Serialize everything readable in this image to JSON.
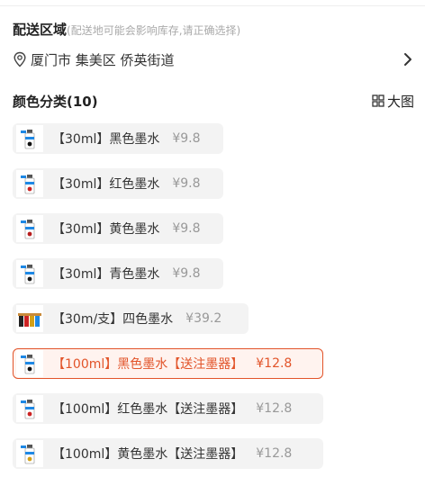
{
  "delivery": {
    "title": "配送区域",
    "hint": "(配送地可能会影响库存,请正确选择)",
    "address": "厦门市 集美区 侨英街道"
  },
  "colors": {
    "label": "颜色分类(10)",
    "big_view": "大图",
    "options": [
      {
        "name": "【30ml】黑色墨水",
        "price": "¥9.8",
        "dot": "#111111",
        "selected": false
      },
      {
        "name": "【30ml】红色墨水",
        "price": "¥9.8",
        "dot": "#cc2222",
        "selected": false
      },
      {
        "name": "【30ml】黄色墨水",
        "price": "¥9.8",
        "dot": "#b71c1c",
        "selected": false
      },
      {
        "name": "【30ml】青色墨水",
        "price": "¥9.8",
        "dot": "#1a1a1a",
        "selected": false
      },
      {
        "name": "【30m/支】四色墨水",
        "price": "¥39.2",
        "dot": "#333333",
        "selected": false
      },
      {
        "name": "【100ml】黑色墨水【送注墨器】",
        "price": "¥12.8",
        "dot": "#111111",
        "selected": true
      },
      {
        "name": "【100ml】红色墨水【送注墨器】",
        "price": "¥12.8",
        "dot": "#cc2222",
        "selected": false
      },
      {
        "name": "【100ml】黄色墨水【送注墨器】",
        "price": "¥12.8",
        "dot": "#d4a017",
        "selected": false
      }
    ]
  },
  "theme": {
    "accent": "#e2542a",
    "chip_bg": "#f3f3f3"
  }
}
